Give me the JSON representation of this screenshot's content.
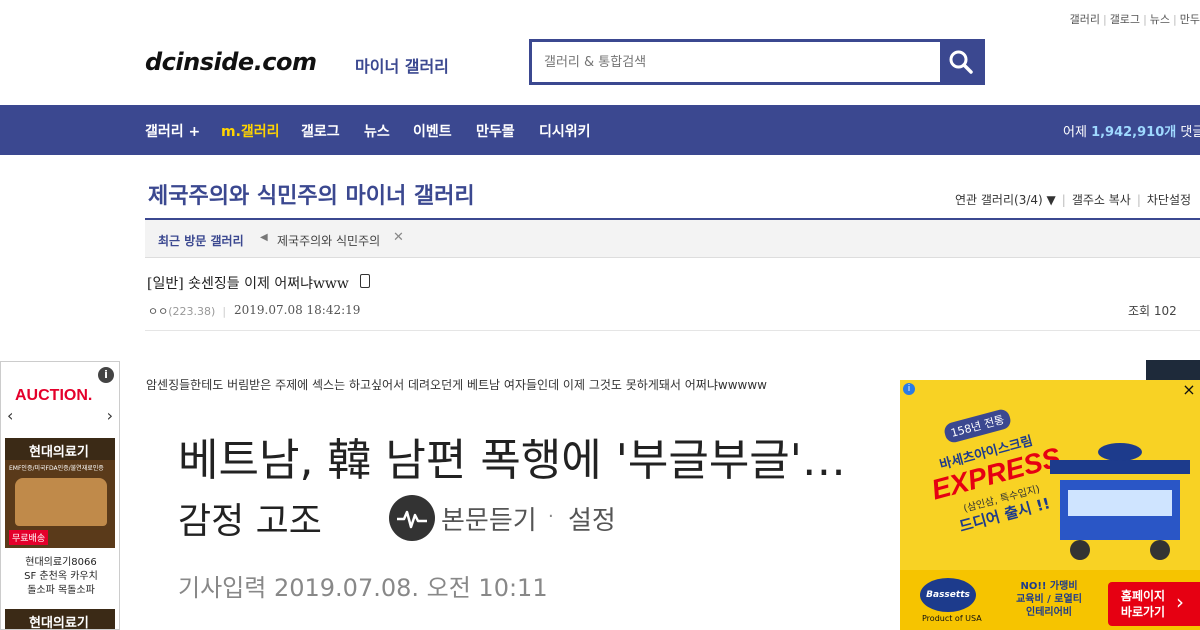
{
  "header": {
    "top_links": [
      "갤러리",
      "갤로그",
      "뉴스",
      "만두"
    ],
    "logo": "dcinside.com",
    "logo_sub": "마이너 갤러리",
    "search_placeholder": "갤러리 & 통합검색"
  },
  "nav": {
    "items": [
      "갤러리 +",
      "m.갤러리",
      "갤로그",
      "뉴스",
      "이벤트",
      "만두몰",
      "디시위키"
    ],
    "stats_prefix": "어제",
    "stats_value": "1,942,910개",
    "stats_suffix": "댓글"
  },
  "gallery": {
    "title": "제국주의와 식민주의 마이너 갤러리",
    "tools": [
      "연관 갤러리(3/4)",
      "갤주소 복사",
      "차단설정"
    ],
    "recent_label": "최근 방문 갤러리",
    "recent_item": "제국주의와 식민주의"
  },
  "post": {
    "title": "[일반] 숏센징들 이제 어쩌냐www",
    "writer": "ㅇㅇ",
    "ip": "(223.38)",
    "date": "2019.07.08 18:42:19",
    "views": "조회 102",
    "body": "암센징들한테도 버림받은 주제에 섹스는 하고싶어서 데려오던게 베트남 여자들인데 이제 그것도 못하게돼서 어쩌냐wwwww"
  },
  "article": {
    "headline_line1": "베트남, 韓 남편 폭행에 '부글부글'…",
    "headline_line2": "감정 고조",
    "listen_label": "본문듣기",
    "dot": "·",
    "settings_label": "설정",
    "date_label": "기사입력",
    "date_value": "2019.07.08. 오전 10:11"
  },
  "left_ad": {
    "info": "i",
    "brand": "AUCTION.",
    "card_title": "현대의료기",
    "card_sub": "EMF인증/미국FDA인증/불연재료인증",
    "free_shipping": "무료배송",
    "desc_line1": "현대의료기8066",
    "desc_line2": "SF 춘천옥 카우치",
    "desc_line3": "돌소파 목돌소파",
    "card2_title": "현대의료기"
  },
  "right_ad": {
    "info": "i",
    "close": "×",
    "anniversary": "158년 전통",
    "brand": "바세츠아이스크림",
    "headline": "EXPRESS",
    "note": "(삼인삼, 특수입지)",
    "launch": "드디어 출시 !!",
    "logo": "Bassetts",
    "made_in": "Product of USA",
    "benefits_line1": "NO!! 가맹비",
    "benefits_line2": "교육비 / 로열티",
    "benefits_line3": "인테리어비",
    "cta": "홈페이지 바로가기",
    "cta_arrow": "›"
  }
}
